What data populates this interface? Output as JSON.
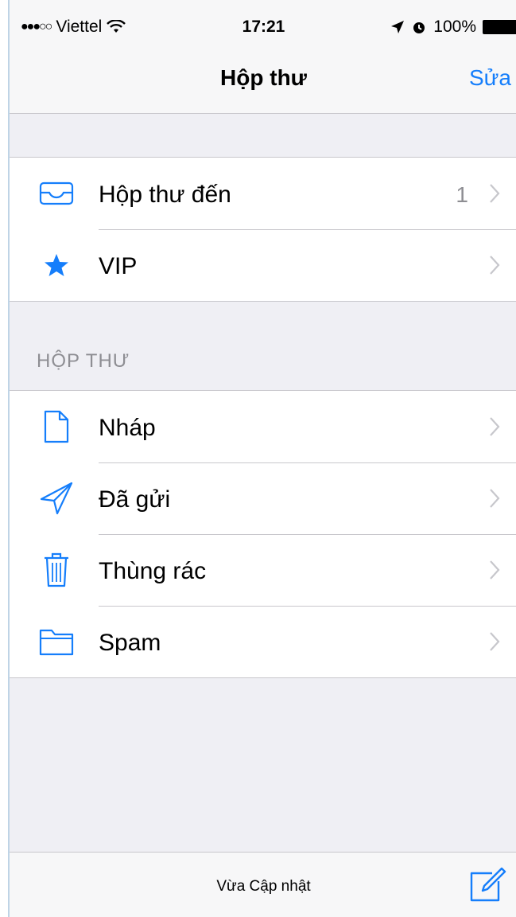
{
  "status_bar": {
    "carrier": "Viettel",
    "time": "17:21",
    "battery": "100%"
  },
  "nav": {
    "title": "Hộp thư",
    "edit_label": "Sửa"
  },
  "top_group": [
    {
      "label": "Hộp thư đến",
      "count": "1",
      "icon": "inbox-icon"
    },
    {
      "label": "VIP",
      "count": "",
      "icon": "star-icon"
    }
  ],
  "section_header": "HỘP THƯ",
  "mailboxes": [
    {
      "label": "Nháp",
      "icon": "draft-document-icon"
    },
    {
      "label": "Đã gửi",
      "icon": "sent-paper-plane-icon"
    },
    {
      "label": "Thùng rác",
      "icon": "trash-icon"
    },
    {
      "label": "Spam",
      "icon": "folder-icon"
    }
  ],
  "bottom_bar": {
    "status_text": "Vừa Cập nhật"
  },
  "colors": {
    "accent": "#157efb",
    "background": "#efeff4",
    "separator": "#c8c7cc",
    "secondary_text": "#8e8e93"
  }
}
